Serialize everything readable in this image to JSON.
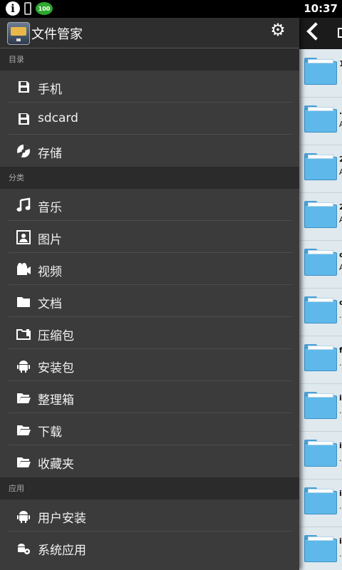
{
  "status": {
    "time": "10:37",
    "battery": "100"
  },
  "drawer": {
    "title": "文件管家",
    "sections": [
      {
        "label": "目录",
        "items": [
          {
            "label": "手机",
            "icon": "sd-card-icon"
          },
          {
            "label": "sdcard",
            "icon": "sd-card-icon"
          },
          {
            "label": "存储",
            "icon": "storage-disc-icon"
          }
        ]
      },
      {
        "label": "分类",
        "items": [
          {
            "label": "音乐",
            "icon": "music-note-icon"
          },
          {
            "label": "图片",
            "icon": "picture-icon"
          },
          {
            "label": "视频",
            "icon": "video-icon"
          },
          {
            "label": "文档",
            "icon": "folder-icon"
          },
          {
            "label": "压缩包",
            "icon": "archive-icon"
          },
          {
            "label": "安装包",
            "icon": "android-icon"
          },
          {
            "label": "整理箱",
            "icon": "open-folder-icon"
          },
          {
            "label": "下载",
            "icon": "open-folder-icon"
          },
          {
            "label": "收藏夹",
            "icon": "open-folder-icon"
          }
        ]
      },
      {
        "label": "应用",
        "items": [
          {
            "label": "用户安装",
            "icon": "android-icon"
          },
          {
            "label": "系统应用",
            "icon": "android-gear-icon"
          }
        ]
      }
    ]
  },
  "behind": {
    "rows": [
      {
        "line1": "1",
        "line2": ""
      },
      {
        "line1": ".",
        "line2": "A"
      },
      {
        "line1": "2",
        "line2": "A"
      },
      {
        "line1": "2",
        "line2": "A"
      },
      {
        "line1": "c",
        "line2": "A"
      },
      {
        "line1": "c",
        "line2": "."
      },
      {
        "line1": "f",
        "line2": "."
      },
      {
        "line1": "i",
        "line2": "."
      },
      {
        "line1": "i",
        "line2": "."
      },
      {
        "line1": "i",
        "line2": "."
      },
      {
        "line1": "i",
        "line2": "."
      }
    ]
  }
}
